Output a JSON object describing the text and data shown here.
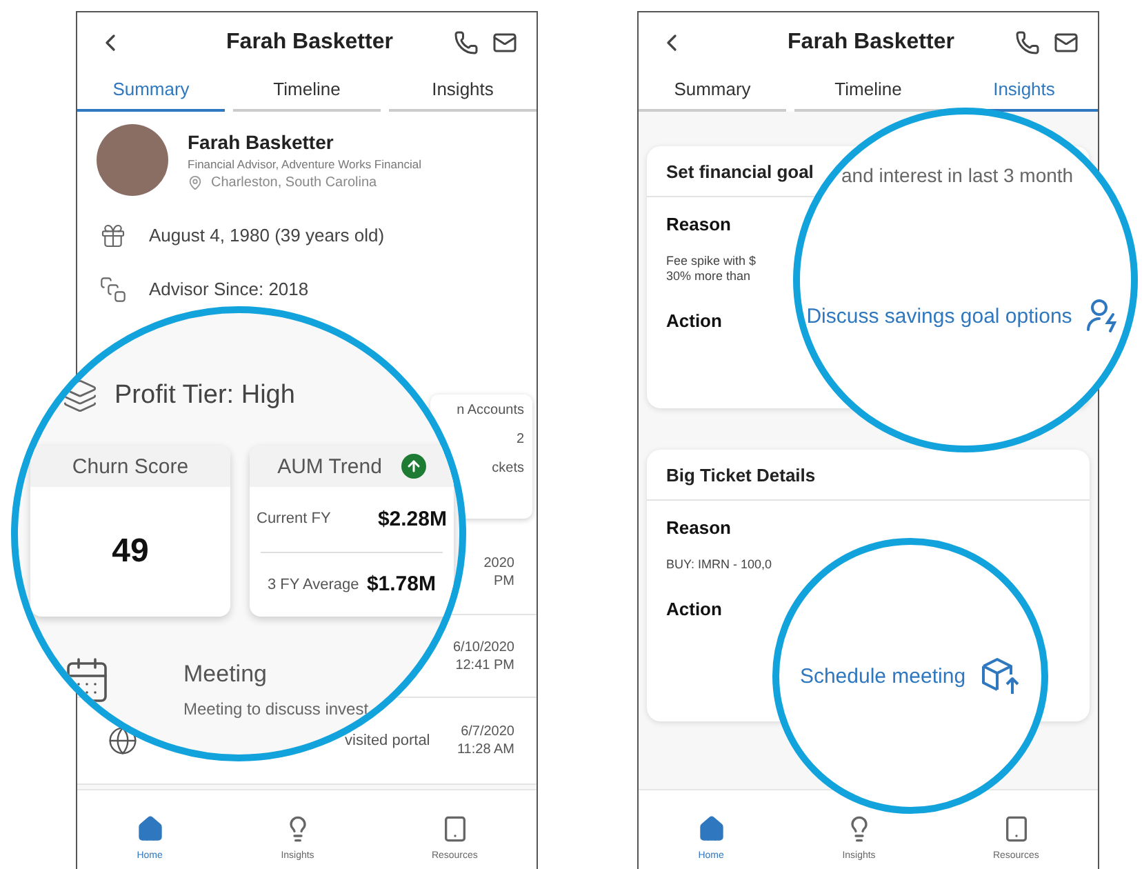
{
  "left_screen": {
    "header": {
      "title": "Farah Basketter"
    },
    "tabs": [
      {
        "label": "Summary",
        "selected": true
      },
      {
        "label": "Timeline",
        "selected": false
      },
      {
        "label": "Insights",
        "selected": false
      }
    ],
    "profile": {
      "name": "Farah Basketter",
      "subtitle": "Financial Advisor, Adventure Works Financial",
      "location": "Charleston, South Carolina"
    },
    "details": [
      {
        "kind": "birthday",
        "text": "August 4, 1980 (39 years old)"
      },
      {
        "kind": "advisor",
        "text": "Advisor Since: 2018"
      }
    ],
    "accounts_card": {
      "title": "n Accounts",
      "value": "2",
      "footer": "ckets"
    },
    "timeline": [
      {
        "date": "2020",
        "time": "PM"
      },
      {
        "date": "6/10/2020",
        "time": "12:41 PM"
      },
      {
        "kind": "portal",
        "text": "visited portal",
        "date": "6/7/2020",
        "time": "11:28 AM"
      }
    ],
    "nav": [
      {
        "label": "Home",
        "selected": true
      },
      {
        "label": "Insights",
        "selected": false
      },
      {
        "label": "Resources",
        "selected": false
      }
    ],
    "magnifier": {
      "profit_tier": "Profit Tier: High",
      "churn": {
        "title": "Churn Score",
        "value": "49"
      },
      "aum": {
        "title": "AUM Trend",
        "rows": [
          {
            "label": "Current FY",
            "value": "$2.28M"
          },
          {
            "label": "3 FY Average",
            "value": "$1.78M"
          }
        ]
      },
      "event": {
        "title": "Meeting",
        "text": "Meeting to discuss invest"
      }
    }
  },
  "right_screen": {
    "header": {
      "title": "Farah Basketter"
    },
    "tabs": [
      {
        "label": "Summary",
        "selected": false
      },
      {
        "label": "Timeline",
        "selected": false
      },
      {
        "label": "Insights",
        "selected": true
      }
    ],
    "cards": [
      {
        "title": "Set financial goal",
        "reason_label": "Reason",
        "reason_lines": [
          "Fee spike with $",
          "30% more than"
        ],
        "action_label": "Action"
      },
      {
        "title": "Big Ticket Details",
        "reason_label": "Reason",
        "reason_lines": [
          "BUY: IMRN - 100,0"
        ],
        "action_label": "Action"
      }
    ],
    "nav": [
      {
        "label": "Home",
        "selected": true
      },
      {
        "label": "Insights",
        "selected": false
      },
      {
        "label": "Resources",
        "selected": false
      }
    ],
    "magnifiers": [
      {
        "caption": "and interest in last 3 month",
        "action": "Discuss savings goal options"
      },
      {
        "action": "Schedule meeting"
      }
    ]
  }
}
